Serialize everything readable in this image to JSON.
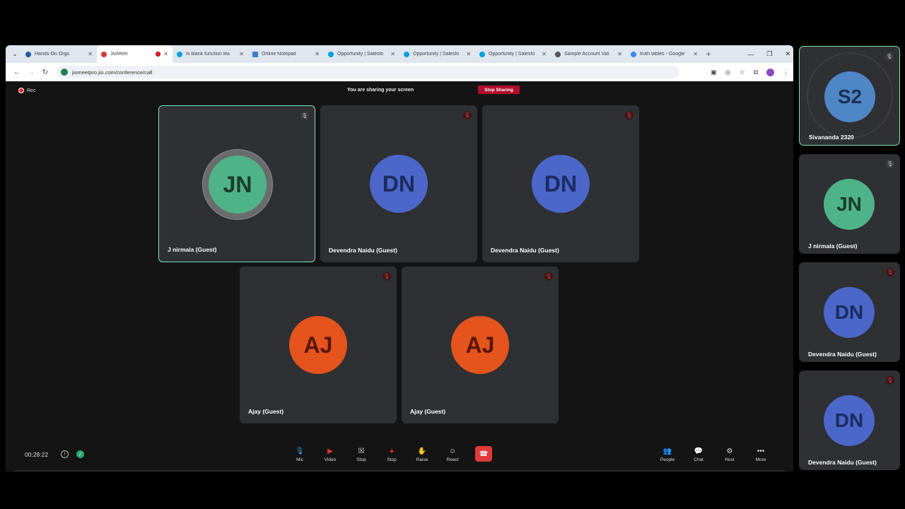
{
  "browser": {
    "tabs": [
      {
        "title": "Hands-On Orgs",
        "favicon": "#1e5aa8"
      },
      {
        "title": "JioMeet",
        "favicon": "#d93636"
      },
      {
        "title": "Is blank function lea",
        "favicon": "#00a1e0"
      },
      {
        "title": "Online Notepad",
        "favicon": "#3a7bd5"
      },
      {
        "title": "Opportunity | Salesfo",
        "favicon": "#00a1e0"
      },
      {
        "title": "Opportunity | Salesfo",
        "favicon": "#00a1e0"
      },
      {
        "title": "Opportunity | Salesfo",
        "favicon": "#00a1e0"
      },
      {
        "title": "Sample Account Vali",
        "favicon": "#555555"
      },
      {
        "title": "truth tables - Google",
        "favicon": "#4285f4"
      }
    ],
    "url": "jiomeetpro.jio.com/conference/call"
  },
  "meeting": {
    "rec_label": "Rec",
    "sharing_text": "You are sharing your screen",
    "stop_sharing_label": "Stop Sharing",
    "timer": "00:28:22",
    "tiles": [
      {
        "initials": "JN",
        "name": "J nirmala (Guest)",
        "mic": "on",
        "speaking": true
      },
      {
        "initials": "DN",
        "name": "Devendra Naidu (Guest)",
        "mic": "off"
      },
      {
        "initials": "DN",
        "name": "Devendra Naidu (Guest)",
        "mic": "off"
      },
      {
        "initials": "AJ",
        "name": "Ajay (Guest)",
        "mic": "off"
      },
      {
        "initials": "AJ",
        "name": "Ajay (Guest)",
        "mic": "off"
      }
    ],
    "controls": [
      {
        "label": "Mic",
        "icon": "mic-icon"
      },
      {
        "label": "Video",
        "icon": "video-off-icon"
      },
      {
        "label": "Stop",
        "icon": "stop-share-icon"
      },
      {
        "label": "Stop",
        "icon": "stop-record-icon"
      },
      {
        "label": "Raise",
        "icon": "raise-hand-icon"
      },
      {
        "label": "React",
        "icon": "react-icon"
      }
    ],
    "right_controls": [
      {
        "label": "People",
        "icon": "people-icon"
      },
      {
        "label": "Chat",
        "icon": "chat-icon"
      },
      {
        "label": "Host",
        "icon": "host-icon"
      },
      {
        "label": "More",
        "icon": "more-icon"
      }
    ]
  },
  "side_panel": [
    {
      "initials": "S2",
      "name": "Sivananda 2320",
      "mic": "on",
      "speaking": true
    },
    {
      "initials": "JN",
      "name": "J nirmala (Guest)",
      "mic": "on"
    },
    {
      "initials": "DN",
      "name": "Devendra Naidu (Guest)",
      "mic": "off"
    },
    {
      "initials": "DN",
      "name": "Devendra Naidu (Guest)",
      "mic": "off"
    }
  ],
  "colors": {
    "speaking_border": "#7fe0b4",
    "stop_sharing_bg": "#b0102b",
    "end_call_bg": "#e23a3a"
  }
}
